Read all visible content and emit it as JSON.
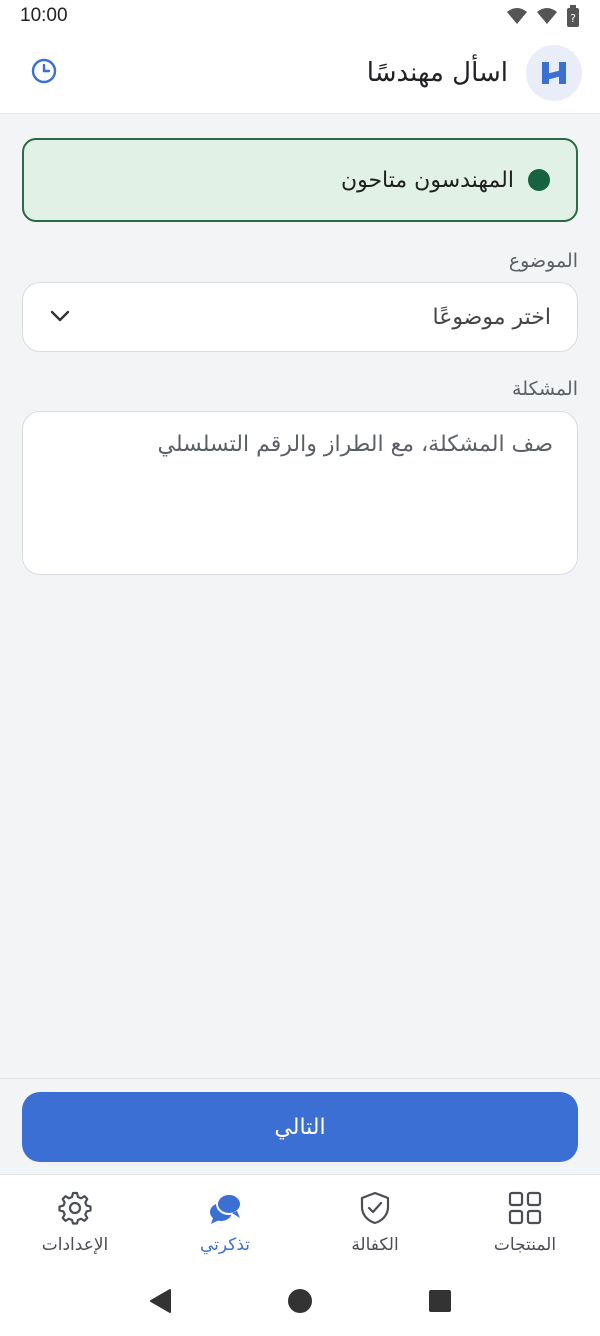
{
  "status_bar": {
    "time": "10:00"
  },
  "app_bar": {
    "title": "اسأل مهندسًا"
  },
  "availability": {
    "text": "المهندسون متاحون"
  },
  "topic_field": {
    "label": "الموضوع",
    "value": "اختر موضوعًا"
  },
  "problem_field": {
    "label": "المشكلة",
    "placeholder": "صف المشكلة، مع الطراز والرقم التسلسلي"
  },
  "next_button": {
    "label": "التالي"
  },
  "bottom_nav": {
    "items": [
      {
        "label": "المنتجات",
        "icon": "grid-icon",
        "active": false
      },
      {
        "label": "الكفالة",
        "icon": "shield-check-icon",
        "active": false
      },
      {
        "label": "تذكرتي",
        "icon": "chat-bubbles-icon",
        "active": true
      },
      {
        "label": "الإعدادات",
        "icon": "gear-icon",
        "active": false
      }
    ]
  },
  "colors": {
    "accent": "#3b6fd4",
    "available": "#17623f",
    "banner_bg": "#e2f1e6"
  }
}
